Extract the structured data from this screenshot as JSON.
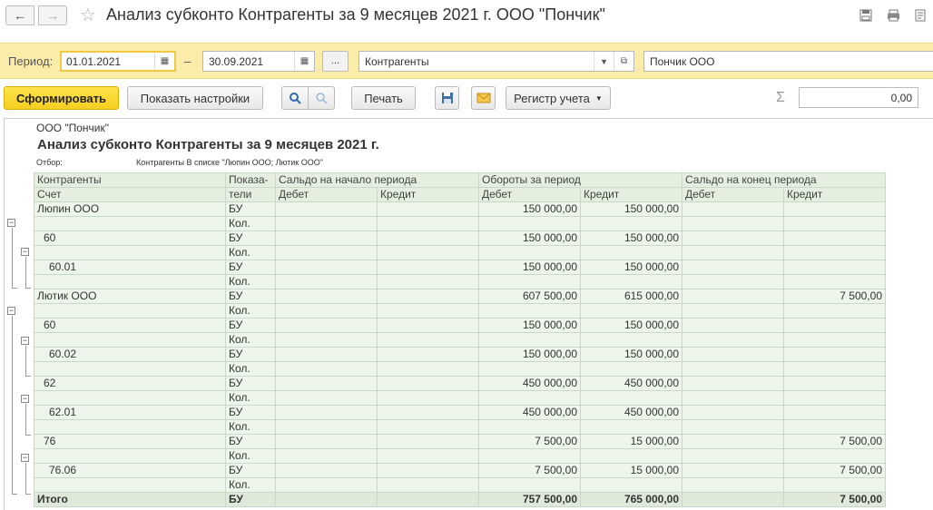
{
  "window": {
    "title": "Анализ субконто Контрагенты за 9 месяцев 2021 г. ООО \"Пончик\"",
    "back_icon": "arrow-left",
    "forward_icon": "arrow-right"
  },
  "params": {
    "period_label": "Период:",
    "date_from": "01.01.2021",
    "date_to": "30.09.2021",
    "dash": "–",
    "dots_label": "...",
    "subconto_type": "Контрагенты",
    "organization": "Пончик ООО"
  },
  "toolbar": {
    "generate_label": "Сформировать",
    "settings_label": "Показать настройки",
    "print_label": "Печать",
    "register_label": "Регистр учета",
    "sum_value": "0,00"
  },
  "report": {
    "org": "ООО \"Пончик\"",
    "title": "Анализ субконто Контрагенты за 9 месяцев 2021 г.",
    "filter_label": "Отбор:",
    "filter_value": "Контрагенты В списке \"Люпин ООО; Лютик ООО\"",
    "headers": {
      "col1_top": "Контрагенты",
      "col1_bottom": "Счет",
      "col2_top": "Показа-",
      "col2_bottom": "тели",
      "open_balance": "Сальдо на начало периода",
      "turnover": "Обороты за период",
      "close_balance": "Сальдо на конец периода",
      "debit": "Дебет",
      "credit": "Кредит"
    },
    "rows": [
      {
        "name": "Люпин ООО",
        "level": 0,
        "ind": "БУ",
        "ob_d": "",
        "ob_c": "",
        "t_d": "150 000,00",
        "t_c": "150 000,00",
        "cb_d": "",
        "cb_c": ""
      },
      {
        "name": "",
        "level": 0,
        "ind": "Кол.",
        "ob_d": "",
        "ob_c": "",
        "t_d": "",
        "t_c": "",
        "cb_d": "",
        "cb_c": ""
      },
      {
        "name": "60",
        "level": 1,
        "ind": "БУ",
        "ob_d": "",
        "ob_c": "",
        "t_d": "150 000,00",
        "t_c": "150 000,00",
        "cb_d": "",
        "cb_c": ""
      },
      {
        "name": "",
        "level": 1,
        "ind": "Кол.",
        "ob_d": "",
        "ob_c": "",
        "t_d": "",
        "t_c": "",
        "cb_d": "",
        "cb_c": ""
      },
      {
        "name": "60.01",
        "level": 2,
        "ind": "БУ",
        "ob_d": "",
        "ob_c": "",
        "t_d": "150 000,00",
        "t_c": "150 000,00",
        "cb_d": "",
        "cb_c": ""
      },
      {
        "name": "",
        "level": 2,
        "ind": "Кол.",
        "ob_d": "",
        "ob_c": "",
        "t_d": "",
        "t_c": "",
        "cb_d": "",
        "cb_c": ""
      },
      {
        "name": "Лютик ООО",
        "level": 0,
        "ind": "БУ",
        "ob_d": "",
        "ob_c": "",
        "t_d": "607 500,00",
        "t_c": "615 000,00",
        "cb_d": "",
        "cb_c": "7 500,00"
      },
      {
        "name": "",
        "level": 0,
        "ind": "Кол.",
        "ob_d": "",
        "ob_c": "",
        "t_d": "",
        "t_c": "",
        "cb_d": "",
        "cb_c": ""
      },
      {
        "name": "60",
        "level": 1,
        "ind": "БУ",
        "ob_d": "",
        "ob_c": "",
        "t_d": "150 000,00",
        "t_c": "150 000,00",
        "cb_d": "",
        "cb_c": ""
      },
      {
        "name": "",
        "level": 1,
        "ind": "Кол.",
        "ob_d": "",
        "ob_c": "",
        "t_d": "",
        "t_c": "",
        "cb_d": "",
        "cb_c": ""
      },
      {
        "name": "60.02",
        "level": 2,
        "ind": "БУ",
        "ob_d": "",
        "ob_c": "",
        "t_d": "150 000,00",
        "t_c": "150 000,00",
        "cb_d": "",
        "cb_c": ""
      },
      {
        "name": "",
        "level": 2,
        "ind": "Кол.",
        "ob_d": "",
        "ob_c": "",
        "t_d": "",
        "t_c": "",
        "cb_d": "",
        "cb_c": ""
      },
      {
        "name": "62",
        "level": 1,
        "ind": "БУ",
        "ob_d": "",
        "ob_c": "",
        "t_d": "450 000,00",
        "t_c": "450 000,00",
        "cb_d": "",
        "cb_c": ""
      },
      {
        "name": "",
        "level": 1,
        "ind": "Кол.",
        "ob_d": "",
        "ob_c": "",
        "t_d": "",
        "t_c": "",
        "cb_d": "",
        "cb_c": ""
      },
      {
        "name": "62.01",
        "level": 2,
        "ind": "БУ",
        "ob_d": "",
        "ob_c": "",
        "t_d": "450 000,00",
        "t_c": "450 000,00",
        "cb_d": "",
        "cb_c": ""
      },
      {
        "name": "",
        "level": 2,
        "ind": "Кол.",
        "ob_d": "",
        "ob_c": "",
        "t_d": "",
        "t_c": "",
        "cb_d": "",
        "cb_c": ""
      },
      {
        "name": "76",
        "level": 1,
        "ind": "БУ",
        "ob_d": "",
        "ob_c": "",
        "t_d": "7 500,00",
        "t_c": "15 000,00",
        "cb_d": "",
        "cb_c": "7 500,00"
      },
      {
        "name": "",
        "level": 1,
        "ind": "Кол.",
        "ob_d": "",
        "ob_c": "",
        "t_d": "",
        "t_c": "",
        "cb_d": "",
        "cb_c": ""
      },
      {
        "name": "76.06",
        "level": 2,
        "ind": "БУ",
        "ob_d": "",
        "ob_c": "",
        "t_d": "7 500,00",
        "t_c": "15 000,00",
        "cb_d": "",
        "cb_c": "7 500,00"
      },
      {
        "name": "",
        "level": 2,
        "ind": "Кол.",
        "ob_d": "",
        "ob_c": "",
        "t_d": "",
        "t_c": "",
        "cb_d": "",
        "cb_c": ""
      },
      {
        "name": "Итого",
        "level": "total",
        "ind": "БУ",
        "ob_d": "",
        "ob_c": "",
        "t_d": "757 500,00",
        "t_c": "765 000,00",
        "cb_d": "",
        "cb_c": "7 500,00"
      }
    ]
  }
}
